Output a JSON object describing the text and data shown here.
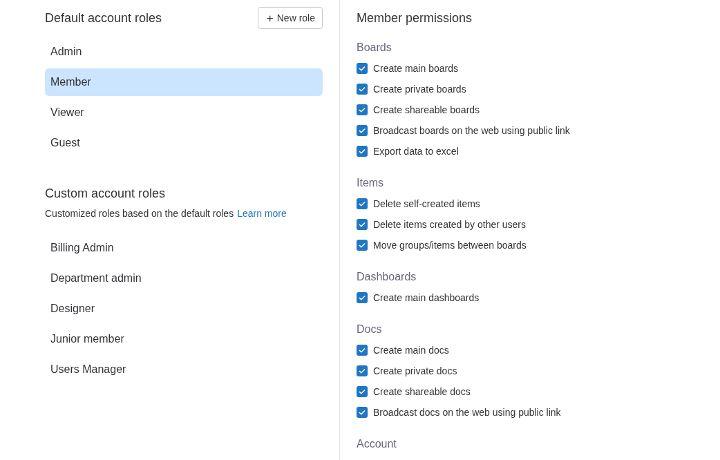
{
  "default_roles": {
    "title": "Default account roles",
    "new_role_button": {
      "icon": "+",
      "label": "New role"
    },
    "items": [
      {
        "label": "Admin",
        "selected": false
      },
      {
        "label": "Member",
        "selected": true
      },
      {
        "label": "Viewer",
        "selected": false
      },
      {
        "label": "Guest",
        "selected": false
      }
    ]
  },
  "custom_roles": {
    "title": "Custom account roles",
    "description": "Customized roles based on the default roles",
    "link": "Learn more",
    "items": [
      {
        "label": "Billing Admin",
        "selected": false
      },
      {
        "label": "Department admin",
        "selected": false
      },
      {
        "label": "Designer",
        "selected": false
      },
      {
        "label": "Junior member",
        "selected": false
      },
      {
        "label": "Users Manager",
        "selected": false
      }
    ]
  },
  "permissions": {
    "title": "Member permissions",
    "sections": [
      {
        "title": "Boards",
        "items": [
          {
            "label": "Create main boards",
            "checked": true
          },
          {
            "label": "Create private boards",
            "checked": true
          },
          {
            "label": "Create shareable boards",
            "checked": true
          },
          {
            "label": "Broadcast boards on the web using public link",
            "checked": true
          },
          {
            "label": "Export data to excel",
            "checked": true
          }
        ]
      },
      {
        "title": "Items",
        "items": [
          {
            "label": "Delete self-created items",
            "checked": true
          },
          {
            "label": "Delete items created by other users",
            "checked": true
          },
          {
            "label": "Move groups/items between boards",
            "checked": true
          }
        ]
      },
      {
        "title": "Dashboards",
        "items": [
          {
            "label": "Create main dashboards",
            "checked": true
          }
        ]
      },
      {
        "title": "Docs",
        "items": [
          {
            "label": "Create main docs",
            "checked": true
          },
          {
            "label": "Create private docs",
            "checked": true
          },
          {
            "label": "Create shareable docs",
            "checked": true
          },
          {
            "label": "Broadcast docs on the web using public link",
            "checked": true
          }
        ]
      },
      {
        "title": "Account"
      }
    ]
  }
}
